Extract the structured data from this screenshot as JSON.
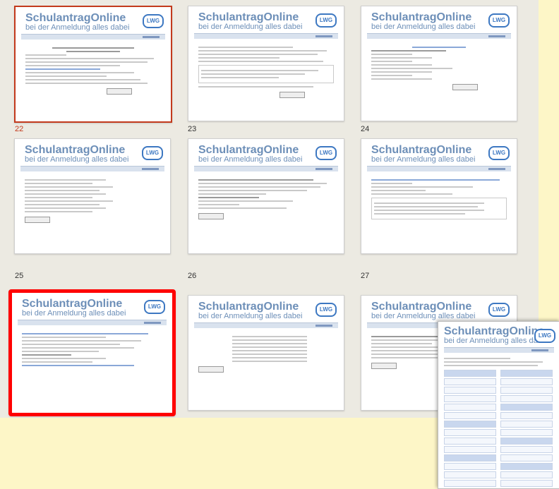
{
  "brand": {
    "title": "SchulantragOnline",
    "subtitle": "bei der Anmeldung alles dabei",
    "logo_text": "LWG"
  },
  "thumbnails": [
    {
      "page": "22",
      "state": "current"
    },
    {
      "page": "23",
      "state": "normal"
    },
    {
      "page": "24",
      "state": "normal"
    },
    {
      "page": "25",
      "state": "normal"
    },
    {
      "page": "26",
      "state": "normal"
    },
    {
      "page": "27",
      "state": "normal"
    },
    {
      "page": "",
      "state": "marked"
    },
    {
      "page": "",
      "state": "normal"
    },
    {
      "page": "",
      "state": "normal"
    }
  ],
  "colors": {
    "background": "#fdf6c7",
    "grid_background": "#eceae2",
    "current_border": "#c33a1c",
    "marked_border": "#ff0000",
    "brand_text": "#6d8fb8",
    "logo": "#3d78c2"
  }
}
